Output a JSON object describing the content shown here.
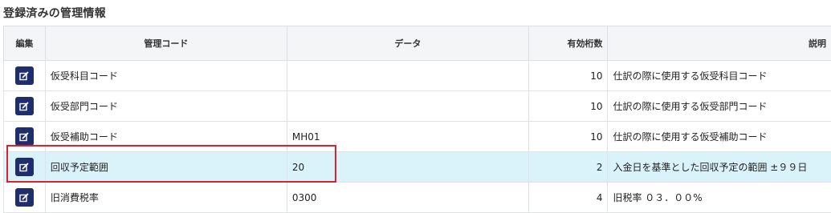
{
  "page": {
    "title": "登録済みの管理情報"
  },
  "columns": {
    "edit": "編集",
    "code": "管理コード",
    "data": "データ",
    "digits": "有効桁数",
    "desc": "説明"
  },
  "rows": [
    {
      "code": "仮受科目コード",
      "data": "",
      "digits": "10",
      "desc": "仕訳の際に使用する仮受科目コード"
    },
    {
      "code": "仮受部門コード",
      "data": "",
      "digits": "10",
      "desc": "仕訳の際に使用する仮受部門コード"
    },
    {
      "code": "仮受補助コード",
      "data": "MH01",
      "digits": "10",
      "desc": "仕訳の際に使用する仮受補助コード"
    },
    {
      "code": "回収予定範囲",
      "data": "20",
      "digits": "2",
      "desc": "入金日を基準とした回収予定の範囲 ±９９日"
    },
    {
      "code": "旧消費税率",
      "data": "0300",
      "digits": "4",
      "desc": "旧税率 ０３．００%"
    }
  ],
  "icons": {
    "edit_button": "edit-icon"
  },
  "colors": {
    "edit_button_bg": "#1e2d6b",
    "selected_row_bg": "#daf3fb",
    "highlight_border": "#d9232d"
  }
}
